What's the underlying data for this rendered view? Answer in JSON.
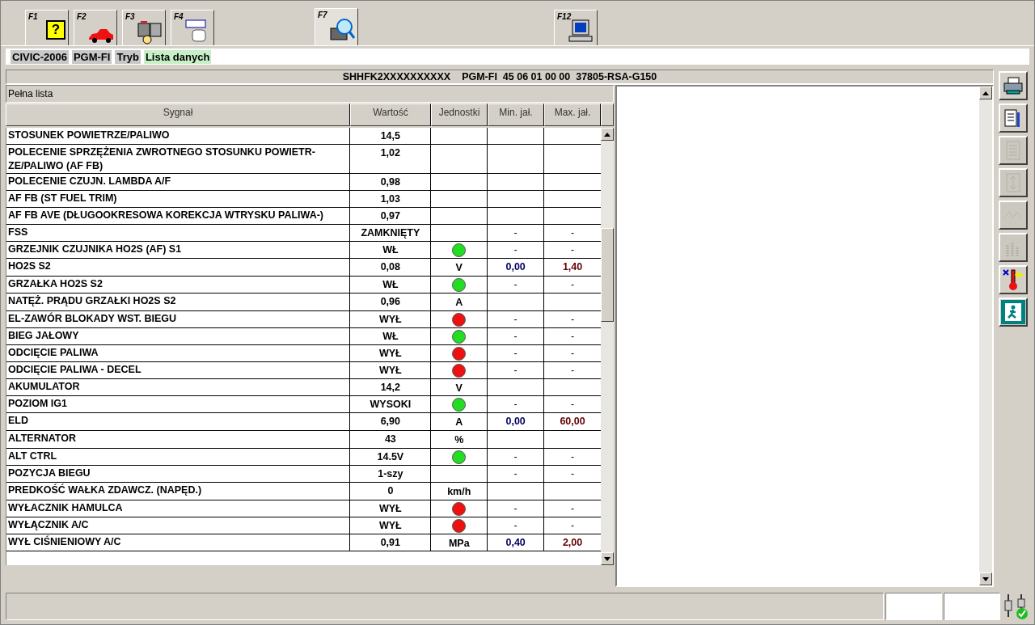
{
  "tabs": [
    {
      "key": "F1",
      "symbol": "?",
      "selected": false
    },
    {
      "key": "F2",
      "selected": false
    },
    {
      "key": "F3",
      "selected": false
    },
    {
      "key": "F4",
      "selected": false
    },
    {
      "key": "F7",
      "selected": true
    },
    {
      "key": "F12",
      "selected": false
    }
  ],
  "breadcrumb": [
    {
      "text": "CIVIC-2006",
      "kind": "plain"
    },
    {
      "text": "PGM-FI",
      "kind": "plain"
    },
    {
      "text": "Tryb",
      "kind": "plain"
    },
    {
      "text": "Lista danych",
      "kind": "current"
    }
  ],
  "info_bar": [
    "SHHFK2XXXXXXXXXX",
    "PGM-FI  45 06 01 00 00  37805-RSA-G150"
  ],
  "list_title": "Pełna lista",
  "table": {
    "columns": [
      "Sygnał",
      "Wartość",
      "Jednostki",
      "Min. jał.",
      "Max. jał."
    ],
    "rows": [
      {
        "signal": "STOSUNEK POWIETRZE/PALIWO",
        "value": "14,5"
      },
      {
        "signal": "POLECENIE SPRZĘŻENIA ZWROTNEGO STOSUNKU POWIETR-ZE/PALIWO (AF FB)",
        "value": "1,02"
      },
      {
        "signal": "POLECENIE CZUJN. LAMBDA A/F",
        "value": "0,98"
      },
      {
        "signal": "AF FB (ST FUEL TRIM)",
        "value": "1,03"
      },
      {
        "signal": "AF FB AVE (DŁUGOOKRESOWA KOREKCJA WTRYSKU PALIWA-)",
        "value": "0,97"
      },
      {
        "signal": "FSS",
        "value": "ZAMKNIĘTY",
        "min": "-",
        "max": "-"
      },
      {
        "signal": "GRZEJNIK CZUJNIKA HO2S (AF) S1",
        "value": "WŁ",
        "indicator": {
          "color": "#22dd22"
        },
        "min": "-",
        "max": "-"
      },
      {
        "signal": "HO2S S2",
        "value": "0,08",
        "unit": "V",
        "min": "0,00",
        "max": "1,40"
      },
      {
        "signal": "GRZAŁKA HO2S S2",
        "value": "WŁ",
        "indicator": {
          "color": "#22dd22"
        },
        "min": "-",
        "max": "-"
      },
      {
        "signal": "NATĘŻ. PRĄDU GRZAŁKI HO2S S2",
        "value": "0,96",
        "unit": "A"
      },
      {
        "signal": "EL-ZAWÓR BLOKADY WST. BIEGU",
        "value": "WYŁ",
        "indicator": {
          "color": "#ee1111"
        },
        "min": "-",
        "max": "-"
      },
      {
        "signal": "BIEG JAŁOWY",
        "value": "WŁ",
        "indicator": {
          "color": "#22dd22"
        },
        "min": "-",
        "max": "-"
      },
      {
        "signal": "ODCIĘCIE PALIWA",
        "value": "WYŁ",
        "indicator": {
          "color": "#ee1111"
        },
        "min": "-",
        "max": "-"
      },
      {
        "signal": "ODCIĘCIE PALIWA - DECEL",
        "value": "WYŁ",
        "indicator": {
          "color": "#ee1111"
        },
        "min": "-",
        "max": "-"
      },
      {
        "signal": "AKUMULATOR",
        "value": "14,2",
        "unit": "V"
      },
      {
        "signal": "POZIOM IG1",
        "value": "WYSOKI",
        "indicator": {
          "color": "#22dd22"
        },
        "min": "-",
        "max": "-"
      },
      {
        "signal": "ELD",
        "value": "6,90",
        "unit": "A",
        "min": "0,00",
        "max": "60,00"
      },
      {
        "signal": "ALTERNATOR",
        "value": "43",
        "unit": "%"
      },
      {
        "signal": "ALT CTRL",
        "value": "14.5V",
        "indicator": {
          "color": "#22dd22"
        },
        "min": "-",
        "max": "-"
      },
      {
        "signal": "POZYCJA BIEGU",
        "value": "1-szy",
        "min": "-",
        "max": "-"
      },
      {
        "signal": "PREDKOŚĆ WAŁKA ZDAWCZ. (NAPĘD.)",
        "value": "0",
        "unit": "km/h"
      },
      {
        "signal": "WYŁACZNIK HAMULCA",
        "value": "WYŁ",
        "indicator": {
          "color": "#ee1111"
        },
        "min": "-",
        "max": "-"
      },
      {
        "signal": "WYŁĄCZNIK A/C",
        "value": "WYŁ",
        "indicator": {
          "color": "#ee1111"
        },
        "min": "-",
        "max": "-"
      },
      {
        "signal": "WYŁ CIŚNIENIOWY A/C",
        "value": "0,91",
        "unit": "MPa",
        "min": "0,40",
        "max": "2,00"
      }
    ]
  },
  "side_tools": [
    {
      "disabled": false
    },
    {
      "disabled": false
    },
    {
      "disabled": true
    },
    {
      "disabled": true
    },
    {
      "disabled": true
    },
    {
      "disabled": true
    },
    {
      "disabled": false
    },
    {
      "disabled": false
    }
  ]
}
